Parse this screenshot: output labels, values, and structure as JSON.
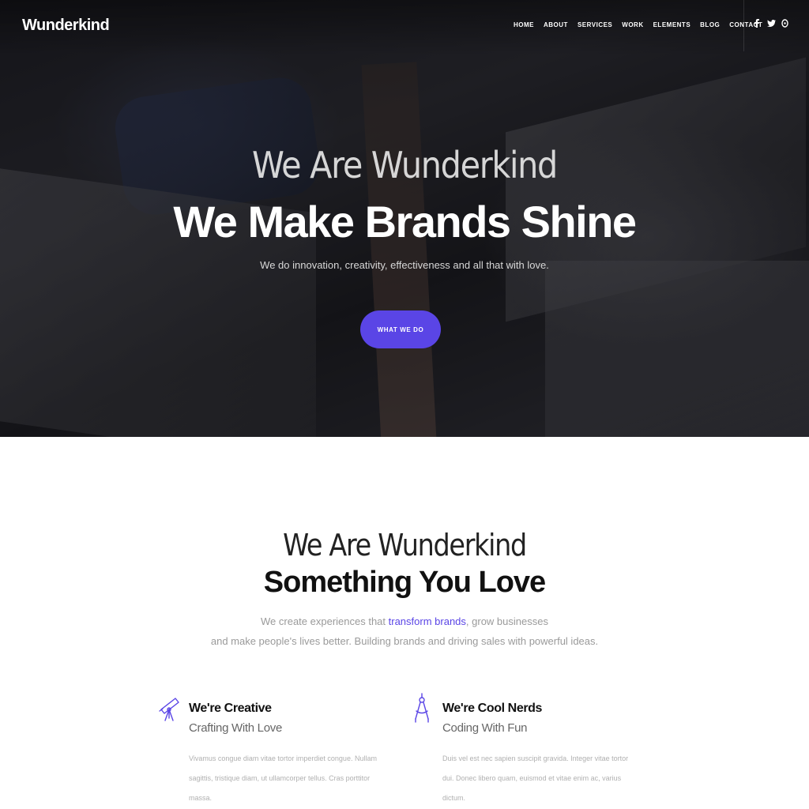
{
  "header": {
    "logo": "Wunderkind",
    "nav": [
      "HOME",
      "ABOUT",
      "SERVICES",
      "WORK",
      "ELEMENTS",
      "BLOG",
      "CONTACT"
    ],
    "social": [
      {
        "icon": "facebook-icon",
        "glyph": "f"
      },
      {
        "icon": "twitter-icon",
        "glyph": "🐦"
      },
      {
        "icon": "dribbble-icon",
        "glyph": "◎"
      }
    ]
  },
  "hero": {
    "subtitle": "We Are Wunderkind",
    "title": "We Make Brands Shine",
    "description": "We do innovation, creativity, effectiveness and all that with love.",
    "button": "WHAT WE DO"
  },
  "about": {
    "subtitle": "We Are Wunderkind",
    "title": "Something You Love",
    "desc_line1_pre": "We create experiences that ",
    "desc_line1_link": "transform brands",
    "desc_line1_post": ", grow businesses",
    "desc_line2": "and make people's lives better. Building brands and driving sales with powerful ideas."
  },
  "features": [
    {
      "icon": "telescope-icon",
      "title": "We're Creative",
      "subtitle": "Crafting With Love",
      "text": "Vivamus congue diam vitae tortor imperdiet congue. Nullam sagittis, tristique diam, ut ullamcorper tellus. Cras porttitor massa."
    },
    {
      "icon": "compass-icon",
      "title": "We're Cool Nerds",
      "subtitle": "Coding With Fun",
      "text": "Duis vel est nec sapien suscipit gravida. Integer vitae tortor dui. Donec libero quam, euismod et vitae enim ac, varius dictum."
    }
  ],
  "colors": {
    "accent": "#5a45e6",
    "hero_text": "#ffffff",
    "body_text": "#111111",
    "muted_text": "#9a9a9a"
  }
}
